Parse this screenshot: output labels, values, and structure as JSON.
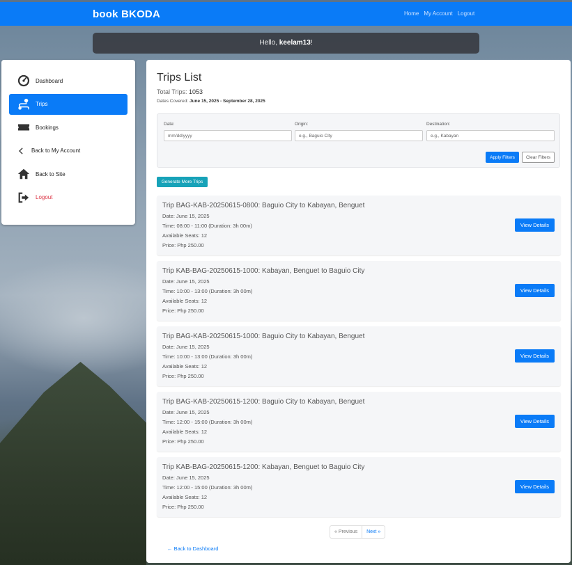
{
  "navbar": {
    "brand": "book BKODA",
    "links": [
      "Home",
      "My Account",
      "Logout"
    ]
  },
  "greeting": {
    "prefix": "Hello, ",
    "username": "keelam13",
    "suffix": "!"
  },
  "sidebar": {
    "items": [
      {
        "label": "Dashboard",
        "icon": "dashboard-icon",
        "active": false
      },
      {
        "label": "Trips",
        "icon": "route-icon",
        "active": true
      },
      {
        "label": "Bookings",
        "icon": "ticket-icon",
        "active": false
      },
      {
        "label": "Back to My Account",
        "icon": "chevron-left-icon",
        "active": false
      },
      {
        "label": "Back to Site",
        "icon": "home-icon",
        "active": false
      },
      {
        "label": "Logout",
        "icon": "logout-icon",
        "active": false
      }
    ]
  },
  "main": {
    "title": "Trips List",
    "total_label": "Total Trips: ",
    "total_value": "1053",
    "covered_label": "Dates Covered: ",
    "covered_value": "June 15, 2025 - September 28, 2025",
    "filters": {
      "date_label": "Date:",
      "date_placeholder": "mm/dd/yyyy",
      "origin_label": "Origin:",
      "origin_placeholder": "e.g., Baguio City",
      "destination_label": "Destination:",
      "destination_placeholder": "e.g., Kabayan",
      "apply_label": "Apply Filters",
      "clear_label": "Clear Filters"
    },
    "generate_label": "Generate More Trips",
    "trips": [
      {
        "title": "Trip BAG-KAB-20250615-0800: Baguio City to Kabayan, Benguet",
        "date": "Date: June 15, 2025",
        "time": "Time: 08:00 - 11:00 (Duration: 3h 00m)",
        "seats": "Available Seats: 12",
        "price": "Price: Php 250.00"
      },
      {
        "title": "Trip KAB-BAG-20250615-1000: Kabayan, Benguet to Baguio City",
        "date": "Date: June 15, 2025",
        "time": "Time: 10:00 - 13:00 (Duration: 3h 00m)",
        "seats": "Available Seats: 12",
        "price": "Price: Php 250.00"
      },
      {
        "title": "Trip BAG-KAB-20250615-1000: Baguio City to Kabayan, Benguet",
        "date": "Date: June 15, 2025",
        "time": "Time: 10:00 - 13:00 (Duration: 3h 00m)",
        "seats": "Available Seats: 12",
        "price": "Price: Php 250.00"
      },
      {
        "title": "Trip BAG-KAB-20250615-1200: Baguio City to Kabayan, Benguet",
        "date": "Date: June 15, 2025",
        "time": "Time: 12:00 - 15:00 (Duration: 3h 00m)",
        "seats": "Available Seats: 12",
        "price": "Price: Php 250.00"
      },
      {
        "title": "Trip KAB-BAG-20250615-1200: Kabayan, Benguet to Baguio City",
        "date": "Date: June 15, 2025",
        "time": "Time: 12:00 - 15:00 (Duration: 3h 00m)",
        "seats": "Available Seats: 12",
        "price": "Price: Php 250.00"
      }
    ],
    "view_label": "View Details",
    "pager": {
      "prev": "« Previous",
      "next": "Next »"
    },
    "back_label": "← Back to Dashboard"
  },
  "colors": {
    "primary": "#0a7bf7",
    "info": "#17a2b8",
    "danger": "#dc3545"
  }
}
